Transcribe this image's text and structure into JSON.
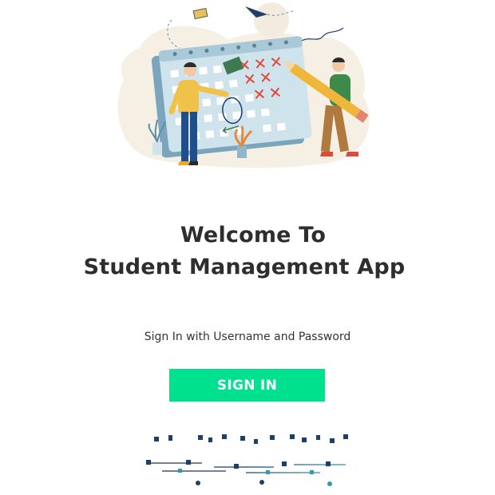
{
  "welcome": {
    "title_line1": "Welcome To",
    "title_line2": "Student Management App",
    "subtitle": "Sign In with Username and Password"
  },
  "actions": {
    "signin_label": "SIGN IN"
  },
  "colors": {
    "accent": "#00e18f",
    "text": "#2e2e2e"
  },
  "illustrations": {
    "hero": "calendar-planning-illustration",
    "footer": "network-flow-illustration"
  }
}
